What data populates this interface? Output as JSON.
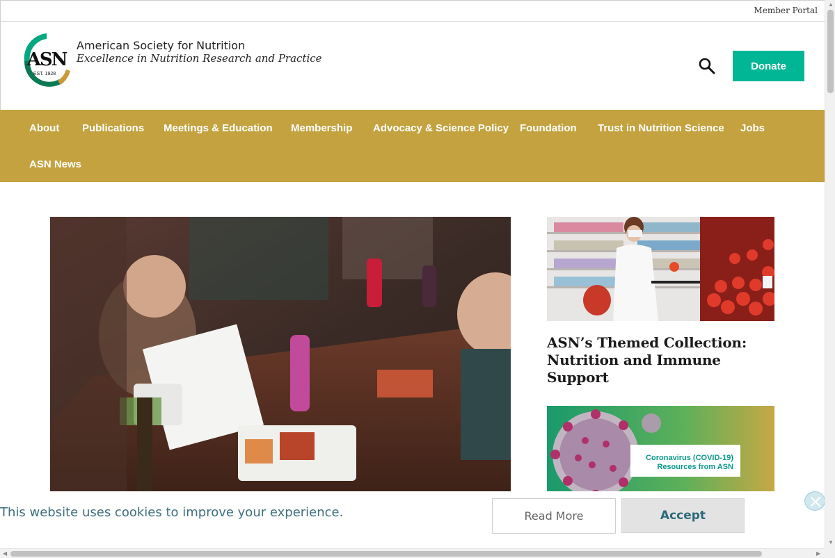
{
  "utility": {
    "member_portal": "Member Portal"
  },
  "header": {
    "logo_text": "ASN",
    "logo_est": "EST. 1928",
    "org_name": "American Society for Nutrition",
    "tagline": "Excellence in Nutrition Research and Practice",
    "donate_label": "Donate"
  },
  "nav": {
    "items": [
      "About",
      "Publications",
      "Meetings & Education",
      "Membership",
      "Advocacy & Science Policy",
      "Foundation",
      "Trust in Nutrition Science",
      "Jobs",
      "ASN News"
    ]
  },
  "cards": {
    "themed_title": "ASN’s Themed Collection: Nutrition and Immune Support",
    "covid_line1": "Coronavirus (COVID-19)",
    "covid_line2": "Resources from ASN"
  },
  "cookie": {
    "message": "This website uses cookies to improve your experience.",
    "read_more": "Read More",
    "accept": "Accept"
  },
  "colors": {
    "nav_gold": "#c4a23f",
    "donate_green": "#00b694",
    "cookie_text": "#3d6f80"
  },
  "icons": {
    "search": "search-icon",
    "close": "close-icon"
  }
}
